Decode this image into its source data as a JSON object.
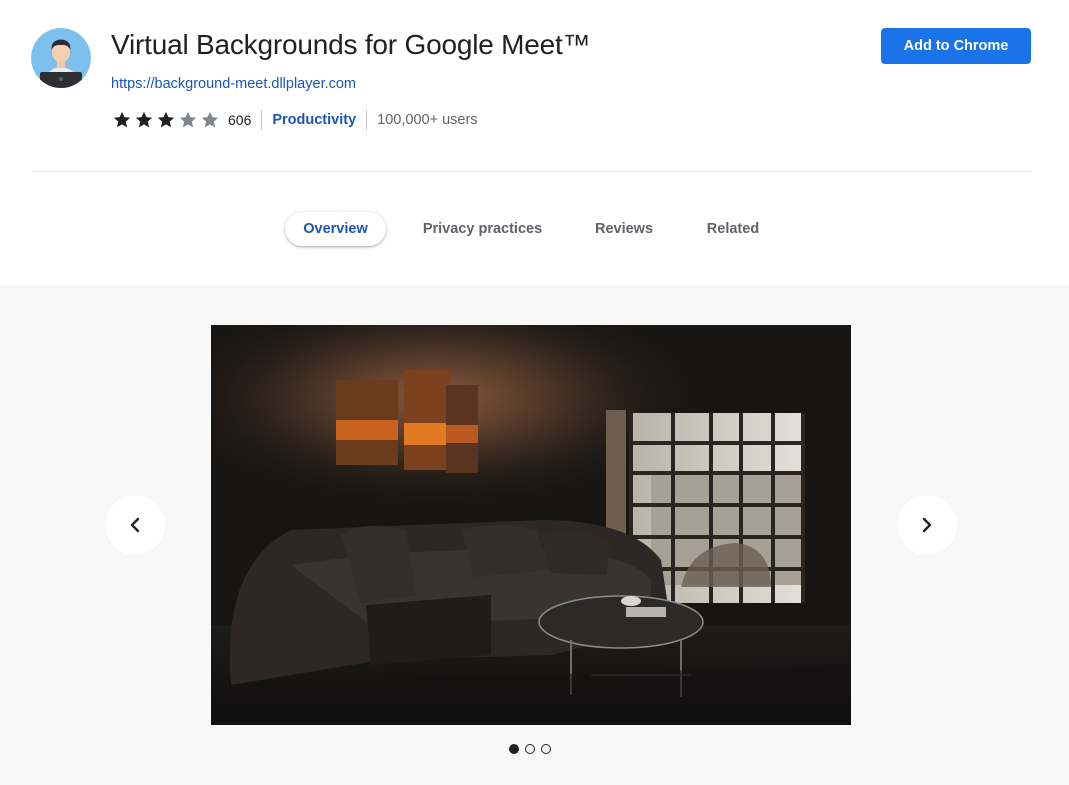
{
  "extension": {
    "title": "Virtual Backgrounds for Google Meet™",
    "url": "https://background-meet.dllplayer.com",
    "rating": 3,
    "rating_max": 5,
    "rating_count": "606",
    "category": "Productivity",
    "users": "100,000+ users",
    "icon": "person-with-laptop-icon"
  },
  "actions": {
    "add_label": "Add to Chrome"
  },
  "tabs": [
    {
      "label": "Overview",
      "active": true
    },
    {
      "label": "Privacy practices",
      "active": false
    },
    {
      "label": "Reviews",
      "active": false
    },
    {
      "label": "Related",
      "active": false
    }
  ],
  "gallery": {
    "slide_count": 3,
    "active_index": 0,
    "prev_icon": "chevron-left-icon",
    "next_icon": "chevron-right-icon"
  },
  "colors": {
    "accent": "#1a73e8",
    "link": "#1a56b8",
    "star_filled": "#202124",
    "star_empty": "#80868b"
  }
}
